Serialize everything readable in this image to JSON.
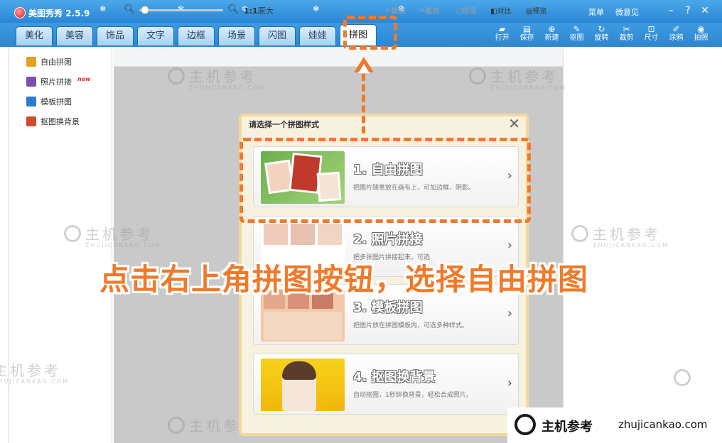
{
  "app": {
    "title": "美图秀秀 2.5.9"
  },
  "top_links": [
    "菜单",
    "微意见"
  ],
  "window_controls": [
    "–",
    "?",
    "✕"
  ],
  "tabs": [
    "美化",
    "美容",
    "饰品",
    "文字",
    "边框",
    "场景",
    "闪图",
    "娃娃",
    "拼图"
  ],
  "active_tab": "拼图",
  "toolbar": [
    {
      "label": "打开",
      "icon": "folder-icon"
    },
    {
      "label": "保存",
      "icon": "save-icon"
    },
    {
      "label": "新建",
      "icon": "new-icon"
    },
    {
      "label": "抠图",
      "icon": "cutout-icon"
    },
    {
      "label": "旋转",
      "icon": "rotate-icon"
    },
    {
      "label": "裁剪",
      "icon": "crop-icon"
    },
    {
      "label": "尺寸",
      "icon": "resize-icon"
    },
    {
      "label": "涂鸦",
      "icon": "brush-icon"
    },
    {
      "label": "拍照",
      "icon": "camera-icon"
    }
  ],
  "sidebar": {
    "items": [
      {
        "label": "自由拼图",
        "icon": "free-puzzle-icon",
        "color": "#e0a020"
      },
      {
        "label": "照片拼接",
        "icon": "photo-join-icon",
        "color": "#7a4fb0",
        "badge": "new"
      },
      {
        "label": "模板拼图",
        "icon": "template-puzzle-icon",
        "color": "#2c7bd0"
      },
      {
        "label": "抠图换背景",
        "icon": "cutout-bg-icon",
        "color": "#d04a2c"
      }
    ]
  },
  "canvas_toolbar": {
    "ratio": "1:1",
    "original_size": "原大",
    "undo": "撤销",
    "redo": "重做",
    "original": "原图",
    "compare": "对比",
    "preview": "预览"
  },
  "dialog": {
    "title": "请选择一个拼图样式",
    "options": [
      {
        "title": "1. 自由拼图",
        "desc": "把图片随意放在画布上，可加边框、阴影。"
      },
      {
        "title": "2. 照片拼接",
        "desc": "把多张图片拼接起来，可选"
      },
      {
        "title": "3. 模板拼图",
        "desc": "把图片放在拼图模板内，可选多种样式。"
      },
      {
        "title": "4. 抠图换背景",
        "desc": "自动抠图，1秒钟换背景，轻松合成照片。"
      }
    ]
  },
  "caption": "点击右上角拼图按钮，选择自由拼图",
  "watermark": {
    "cn": "主机参考",
    "en": "ZHUJICANKAO.COM"
  },
  "brand": {
    "cn": "主机参考",
    "url": "zhujicankao.com"
  },
  "colors": {
    "accent": "#f07a2a",
    "titlebar": "#2b86d3"
  }
}
